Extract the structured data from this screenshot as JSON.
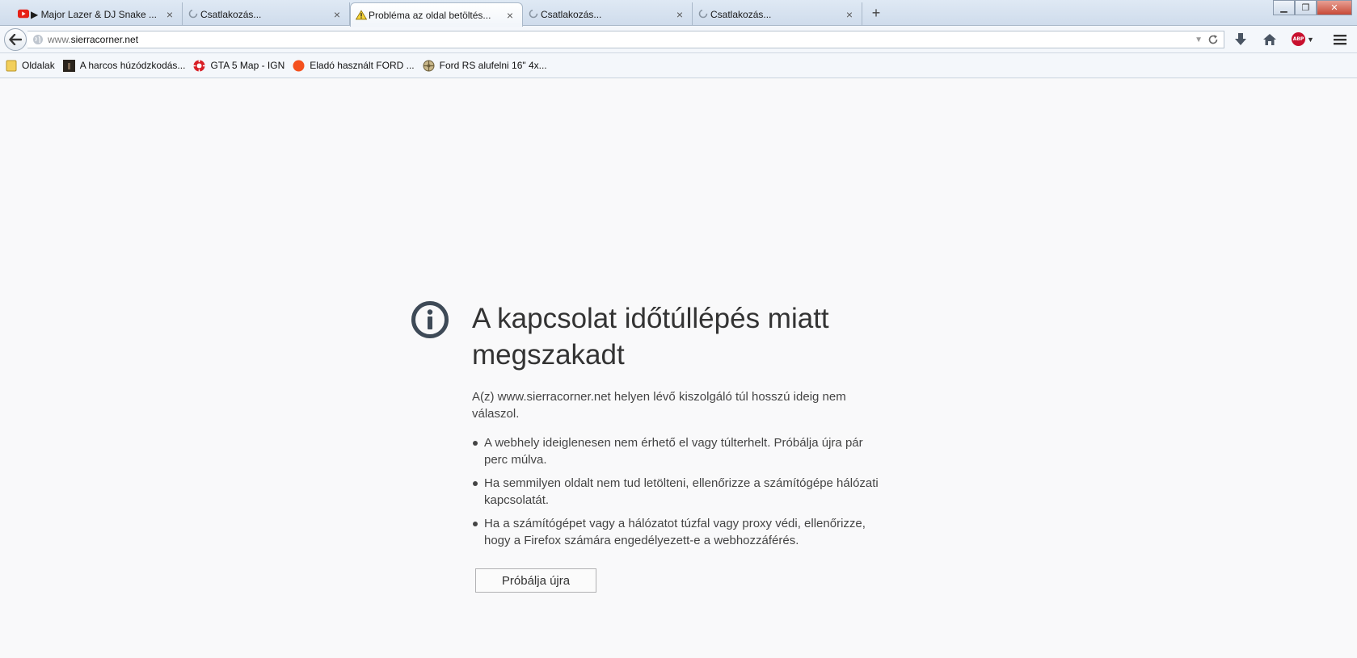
{
  "tabs": [
    {
      "title": "▶ Major Lazer & DJ Snake ...",
      "icon": "youtube-icon",
      "active": false
    },
    {
      "title": "Csatlakozás...",
      "icon": "loading-icon",
      "active": false
    },
    {
      "title": "Probléma az oldal betöltés...",
      "icon": "warning-icon",
      "active": true
    },
    {
      "title": "Csatlakozás...",
      "icon": "loading-icon",
      "active": false
    },
    {
      "title": "Csatlakozás...",
      "icon": "loading-icon",
      "active": false
    }
  ],
  "tab_close_glyph": "×",
  "new_tab_glyph": "+",
  "window": {
    "minimize": "▁",
    "restore": "❐",
    "close": "✕"
  },
  "urlbar": {
    "prefix": "www.",
    "domain": "sierracorner.net"
  },
  "abp_label": "ABP",
  "bookmarks": [
    {
      "label": "Oldalak",
      "icon": "folder-icon"
    },
    {
      "label": "A harcos húzódzkodás...",
      "icon": "dark-thumb-icon"
    },
    {
      "label": "GTA 5 Map - IGN",
      "icon": "ign-icon"
    },
    {
      "label": "Eladó használt FORD ...",
      "icon": "orange-dot-icon"
    },
    {
      "label": "Ford RS alufelni 16\" 4x...",
      "icon": "ford-wheel-icon"
    }
  ],
  "error": {
    "title": "A kapcsolat időtúllépés miatt megszakadt",
    "description": "A(z) www.sierracorner.net helyen lévő kiszolgáló túl hosszú ideig nem válaszol.",
    "bullets": [
      "A webhely ideiglenesen nem érhető el vagy túlterhelt. Próbálja újra pár perc múlva.",
      "Ha semmilyen oldalt nem tud letölteni, ellenőrizze a számítógépe hálózati kapcsolatát.",
      "Ha a számítógépet vagy a hálózatot túzfal vagy proxy védi, ellenőrizze, hogy a Firefox számára engedélyezett-e a webhozzáférés."
    ],
    "retry_label": "Próbálja újra"
  },
  "colors": {
    "icon_dark": "#3e4a57",
    "abp_red": "#c8102e",
    "youtube_red": "#e62117"
  }
}
